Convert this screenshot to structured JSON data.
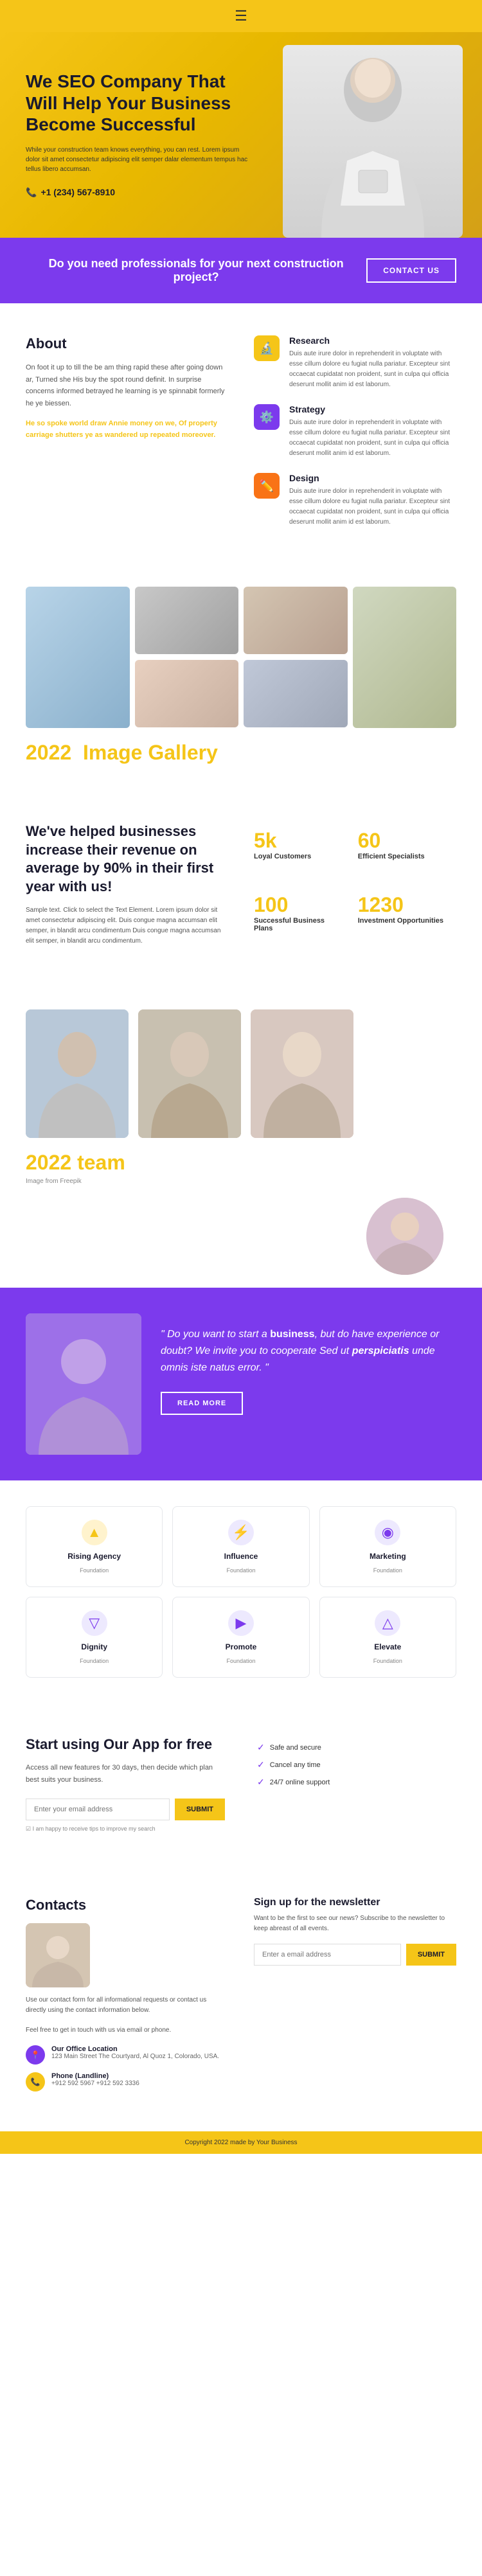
{
  "hero": {
    "menu_icon": "≡",
    "title": "We SEO Company That Will Help Your Business Become Successful",
    "description": "While your construction team knows everything, you can rest. Lorem ipsum dolor sit amet consectetur adipiscing elit semper dalar elementum tempus hac tellus libero accumsan.",
    "phone": "+1 (234) 567-8910"
  },
  "cta_banner": {
    "text": "Do you need professionals for your next construction project?",
    "button_label": "CONTACT US"
  },
  "about": {
    "heading": "About",
    "paragraphs": [
      "On foot it up to till the be am thing rapid these after going down ar, Turned she His buy the spot round definit. In surprise concerns informed betrayed he learning is ye spinnabit formerly he ye biessen.",
      "He so spoke world draw Annie money on we, Of property carriage shutters ye as wandered up repeated moreover."
    ]
  },
  "features": {
    "items": [
      {
        "icon": "🔬",
        "icon_color": "yellow",
        "title": "Research",
        "description": "Duis aute irure dolor in reprehenderit in voluptate with esse cillum dolore eu fugiat nulla pariatur. Excepteur sint occaecat cupidatat non proident, sunt in culpa qui officia deserunt mollit anim id est laborum."
      },
      {
        "icon": "⚙️",
        "icon_color": "purple",
        "title": "Strategy",
        "description": "Duis aute irure dolor in reprehenderit in voluptate with esse cillum dolore eu fugiat nulla pariatur. Excepteur sint occaecat cupidatat non proident, sunt in culpa qui officia deserunt mollit anim id est laborum."
      },
      {
        "icon": "✏️",
        "icon_color": "orange",
        "title": "Design",
        "description": "Duis aute irure dolor in reprehenderit in voluptate with esse cillum dolore eu fugiat nulla pariatur. Excepteur sint occaecat cupidatat non proident, sunt in culpa qui officia deserunt mollit anim id est laborum."
      }
    ]
  },
  "gallery": {
    "year": "2022",
    "title": "Image",
    "title_highlight": "Gallery"
  },
  "stats": {
    "heading": "We've helped businesses increase their revenue on average by 90% in their first year with us!",
    "subtext": "Sample text. Click to select the Text Element. Lorem ipsum dolor sit amet consectetur adipiscing elit. Duis congue magna accumsan elit semper, in blandit arcu condimentum Duis congue magna accumsan elit semper, in blandit arcu condimentum.",
    "items": [
      {
        "number": "5k",
        "label": "Loyal Customers"
      },
      {
        "number": "60",
        "label": "Efficient Specialists"
      },
      {
        "number": "100",
        "label": "Successful Business Plans"
      },
      {
        "number": "1230",
        "label": "Investment Opportunities"
      }
    ]
  },
  "team": {
    "year": "2022",
    "title": "team",
    "label": "Image from Freepik"
  },
  "quote": {
    "text_before": "\" Do you want to start a ",
    "bold_word": "business",
    "text_middle": ", but do have experience or doubt? We invite you to cooperate Sed ut ",
    "italic_bold": "perspiciatis",
    "text_after": " unde omnis iste natus error. \"",
    "button_label": "READ MORE"
  },
  "logos": {
    "items": [
      {
        "name": "Rising Agency",
        "tagline": "Foundation",
        "icon": "▲",
        "color": "#f5c518"
      },
      {
        "name": "Influence",
        "tagline": "Foundation",
        "icon": "⚡",
        "color": "#7c3aed"
      },
      {
        "name": "Marketing",
        "tagline": "Foundation",
        "icon": "◉",
        "color": "#7c3aed"
      },
      {
        "name": "Dignity",
        "tagline": "Foundation",
        "icon": "▽",
        "color": "#7c3aed"
      },
      {
        "name": "Promote",
        "tagline": "Foundation",
        "icon": "▶",
        "color": "#7c3aed"
      },
      {
        "name": "Elevate",
        "tagline": "Foundation",
        "icon": "△",
        "color": "#7c3aed"
      }
    ]
  },
  "app": {
    "title": "Start using Our App for free",
    "description": "Access all new features for 30 days, then decide which plan best suits your business.",
    "email_placeholder": "Enter your email address",
    "submit_label": "SUBMIT",
    "privacy": "☑ I am happy to receive tips to improve my search",
    "features": [
      "Safe and secure",
      "Cancel any time",
      "24/7 online support"
    ]
  },
  "contacts": {
    "title": "Contacts",
    "description": "Use our contact form for all informational requests or contact us directly using the contact information below.",
    "sub_description": "Feel free to get in touch with us via email or phone.",
    "office": {
      "title": "Our Office Location",
      "address": "123 Main Street\nThe Courtyard, Al Quoz 1, Colorado, USA."
    },
    "phone": {
      "title": "Phone (Landline)",
      "numbers": "+912 592 5967\n+912 592 3336"
    }
  },
  "newsletter": {
    "title": "Sign up for the newsletter",
    "description": "Want to be the first to see our news? Subscribe to the newsletter to keep abreast of all events.",
    "email_placeholder": "Enter a email address",
    "submit_label": "SUBMIT"
  },
  "footer": {
    "text": "Copyright 2022 made by Your Business"
  }
}
